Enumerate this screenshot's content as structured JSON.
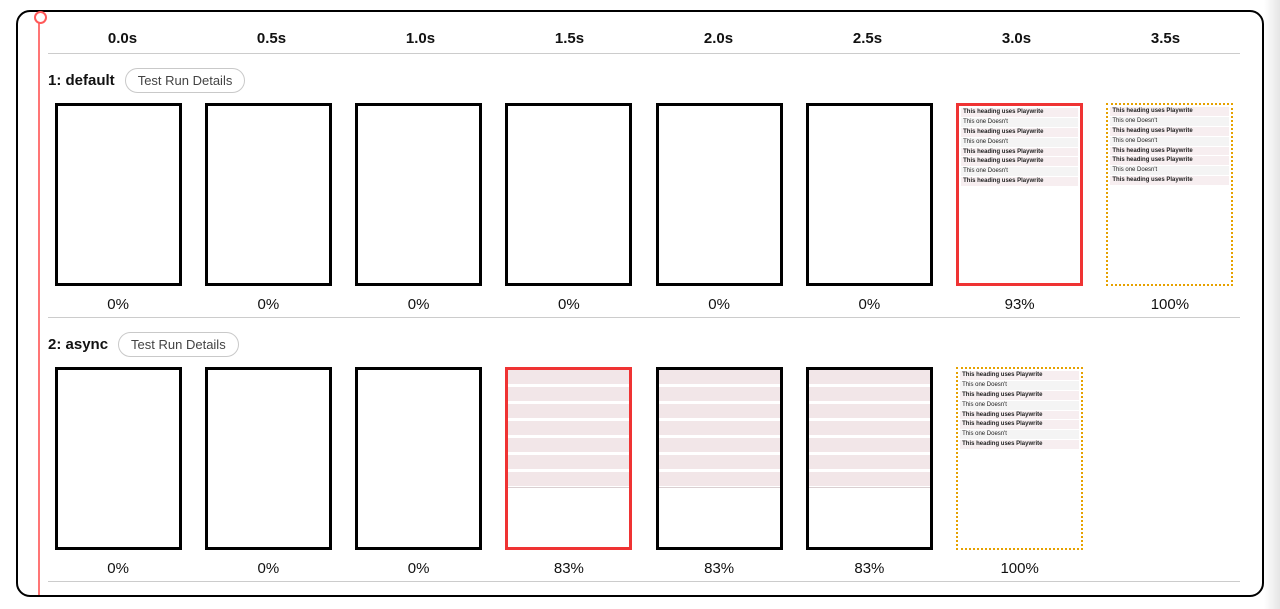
{
  "timeline": [
    "0.0s",
    "0.5s",
    "1.0s",
    "1.5s",
    "2.0s",
    "2.5s",
    "3.0s",
    "3.5s"
  ],
  "button": {
    "details": "Test Run Details"
  },
  "content_lines": [
    "This heading uses Playwrite",
    "This one Doesn't",
    "This heading uses Playwrite",
    "This one Doesn't",
    "This heading uses Playwrite",
    "This heading uses Playwrite",
    "This one Doesn't",
    "This heading uses Playwrite"
  ],
  "rows": [
    {
      "label": "1: default",
      "frames": [
        {
          "pct": "0%",
          "border": "black",
          "content": "blank"
        },
        {
          "pct": "0%",
          "border": "black",
          "content": "blank"
        },
        {
          "pct": "0%",
          "border": "black",
          "content": "blank"
        },
        {
          "pct": "0%",
          "border": "black",
          "content": "blank"
        },
        {
          "pct": "0%",
          "border": "black",
          "content": "blank"
        },
        {
          "pct": "0%",
          "border": "black",
          "content": "blank"
        },
        {
          "pct": "93%",
          "border": "red",
          "content": "text"
        },
        {
          "pct": "100%",
          "border": "gold",
          "content": "text"
        }
      ]
    },
    {
      "label": "2: async",
      "frames": [
        {
          "pct": "0%",
          "border": "black",
          "content": "blank"
        },
        {
          "pct": "0%",
          "border": "black",
          "content": "blank"
        },
        {
          "pct": "0%",
          "border": "black",
          "content": "blank"
        },
        {
          "pct": "83%",
          "border": "red",
          "content": "stripes-half"
        },
        {
          "pct": "83%",
          "border": "black",
          "content": "stripes-half"
        },
        {
          "pct": "83%",
          "border": "black",
          "content": "stripes-half"
        },
        {
          "pct": "100%",
          "border": "gold",
          "content": "text"
        }
      ]
    }
  ]
}
